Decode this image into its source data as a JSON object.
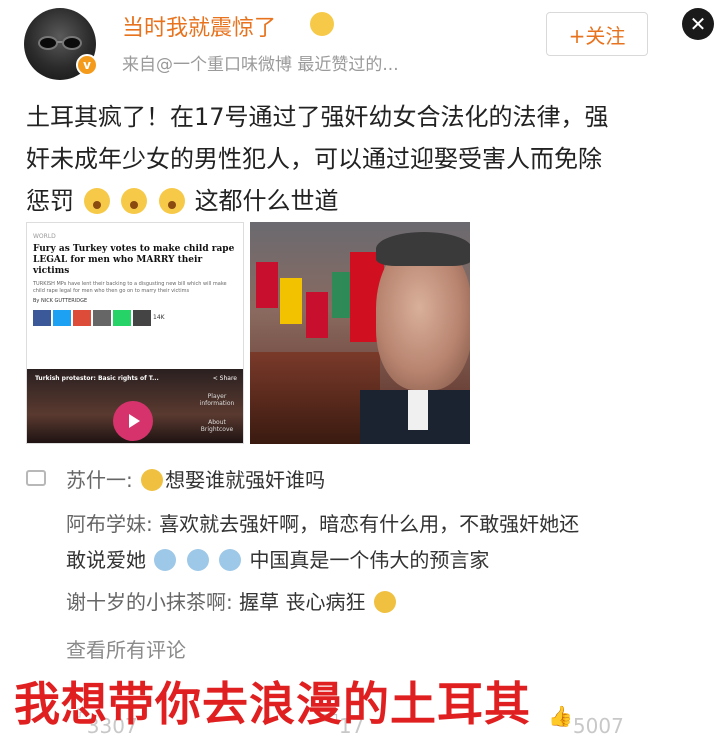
{
  "header": {
    "username": "当时我就震惊了",
    "subline": "来自@一个重口味微博 最近赞过的...",
    "follow_label": "+关注",
    "close_label": "✕"
  },
  "post": {
    "line1": "土耳其疯了！在17号通过了强奸幼女合法化的法律，强",
    "line2": "奸未成年少女的男性犯人，可以通过迎娶受害人而免除",
    "line3_a": "惩罚",
    "line3_b": "这都什么世道"
  },
  "article_image": {
    "section": "WORLD",
    "headline": "Fury as Turkey votes to make child rape LEGAL for men who MARRY their victims",
    "lede": "TURKISH MPs have lent their backing to a disgusting new bill which will make child rape legal for men who then go on to marry their victims",
    "byline": "By NICK GUTTERIDGE",
    "share_count": "14K",
    "video_title": "Turkish protestor: Basic rights of T...",
    "video_share": "< Share",
    "player_info": "Player information",
    "about": "About Brightcove"
  },
  "comments": [
    {
      "name": "苏什一:",
      "text": "想娶谁就强奸谁吗"
    },
    {
      "name": "阿布学妹:",
      "text": "喜欢就去强奸啊，暗恋有什么用，不敢强奸她还",
      "text2a": "敢说爱她",
      "text2b": "中国真是一个伟大的预言家"
    },
    {
      "name": "谢十岁的小抹茶啊:",
      "text": "握草 丧心病狂"
    }
  ],
  "see_all": "查看所有评论",
  "footer": {
    "repost": "3307",
    "comment": "17",
    "like": "5007"
  },
  "overlay_caption": "我想带你去浪漫的土耳其",
  "colors": {
    "accent": "#e8731e",
    "overlay": "#e02020"
  }
}
